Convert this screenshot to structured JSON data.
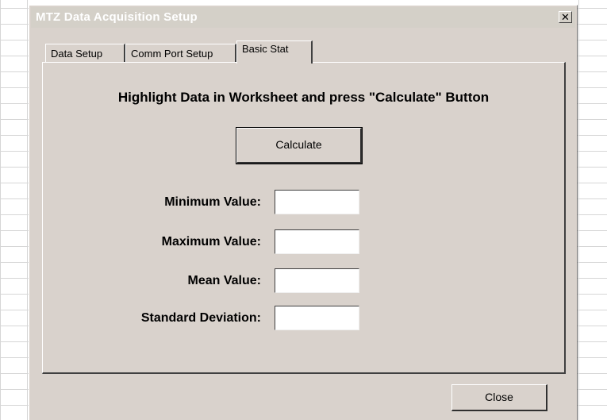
{
  "window": {
    "title": "MTZ Data Acquisition Setup",
    "close_glyph": "✕"
  },
  "tabs": [
    {
      "label": "Data Setup",
      "active": false
    },
    {
      "label": "Comm Port Setup",
      "active": false
    },
    {
      "label": "Basic Stat",
      "active": true
    }
  ],
  "basic_stat": {
    "instruction": "Highlight Data in Worksheet and press \"Calculate\" Button",
    "calculate_label": "Calculate",
    "rows": [
      {
        "label": "Minimum Value:",
        "value": ""
      },
      {
        "label": "Maximum Value:",
        "value": ""
      },
      {
        "label": "Mean Value:",
        "value": ""
      },
      {
        "label": "Standard Deviation:",
        "value": ""
      }
    ]
  },
  "footer": {
    "close_label": "Close"
  },
  "colors": {
    "dialog_face": "#d9d2cc",
    "title_text": "#ffffff",
    "field_bg": "#ffffff"
  }
}
